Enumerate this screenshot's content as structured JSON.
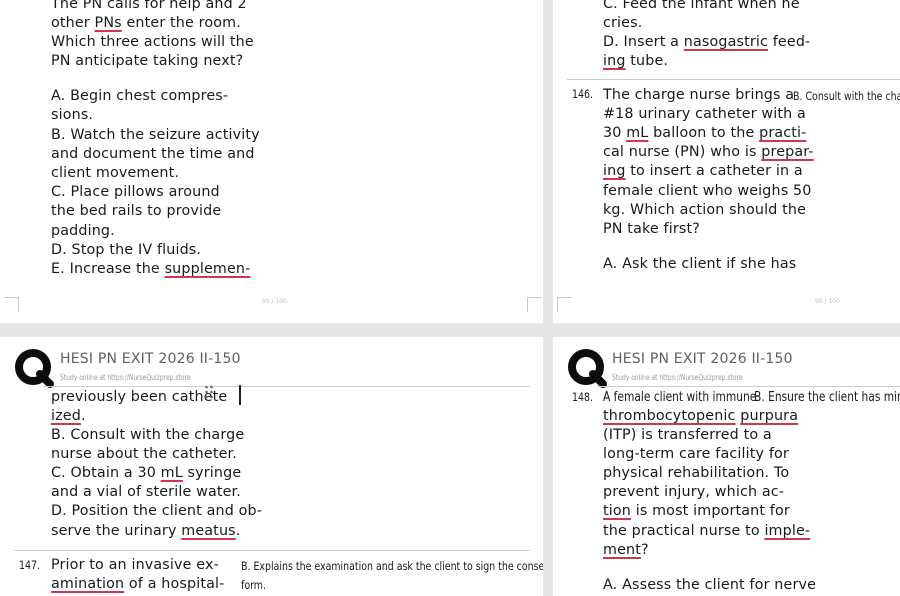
{
  "page1": {
    "lines": [
      "The PN calls for help and 2",
      "other PNs enter the room.",
      "Which three actions will the",
      "PN anticipate taking next?"
    ],
    "options": [
      "A. Begin chest compres-",
      "sions.",
      "B. Watch the seizure activity",
      "and document the time and",
      "client movement.",
      "C. Place pillows around",
      "the bed rails to provide",
      "padding.",
      "D. Stop the IV fluids.",
      "E. Increase the supplemen-"
    ],
    "page_number": "95 / 100"
  },
  "page2": {
    "top_lines": [
      "C. Feed the infant when he",
      "cries.",
      "D. Insert a nasogastric feed-",
      "ing tube."
    ],
    "question_number": "146.",
    "question_lines": [
      "The charge nurse brings a",
      "#18 urinary catheter with a",
      "30 mL balloon to the practi-",
      "cal nurse (PN) who is prepar-",
      "ing to insert a catheter in a",
      "female client who weighs 50",
      "kg. Which action should the",
      "PN take first?"
    ],
    "side_answer": "B. Consult with the charge",
    "option_a": "A. Ask the client if she has",
    "page_number": "96 / 100"
  },
  "header": {
    "title": "HESI PN EXIT 2026 II-150",
    "subtitle": "Study online at https://NurseQuizprep.store"
  },
  "page3": {
    "lines": [
      "previously been cathete",
      "ized.",
      "B.  Consult with the charge",
      "nurse about the catheter.",
      "C.  Obtain a 30 mL syringe",
      "and a vial of sterile water.",
      "D.  Position the client and ob-",
      "serve the urinary meatus."
    ],
    "question_number": "147.",
    "question_lines": [
      "Prior to an invasive ex-",
      "amination of a hospital-"
    ],
    "side_answer_lines": [
      "B. Explains the examination and ask the client to sign the consent",
      "form."
    ]
  },
  "page4": {
    "question_number": "148.",
    "first_line": "A female client with immune",
    "side_answer": "B. Ensure the client has minim",
    "question_lines": [
      "thrombocytopenic purpura",
      "(ITP) is transferred to a",
      "long-term care facility for",
      "physical rehabilitation. To",
      "prevent injury, which ac-",
      "tion is most important for",
      "the practical nurse to imple-",
      "ment?"
    ],
    "option_a": "A. Assess the client for nerve"
  }
}
